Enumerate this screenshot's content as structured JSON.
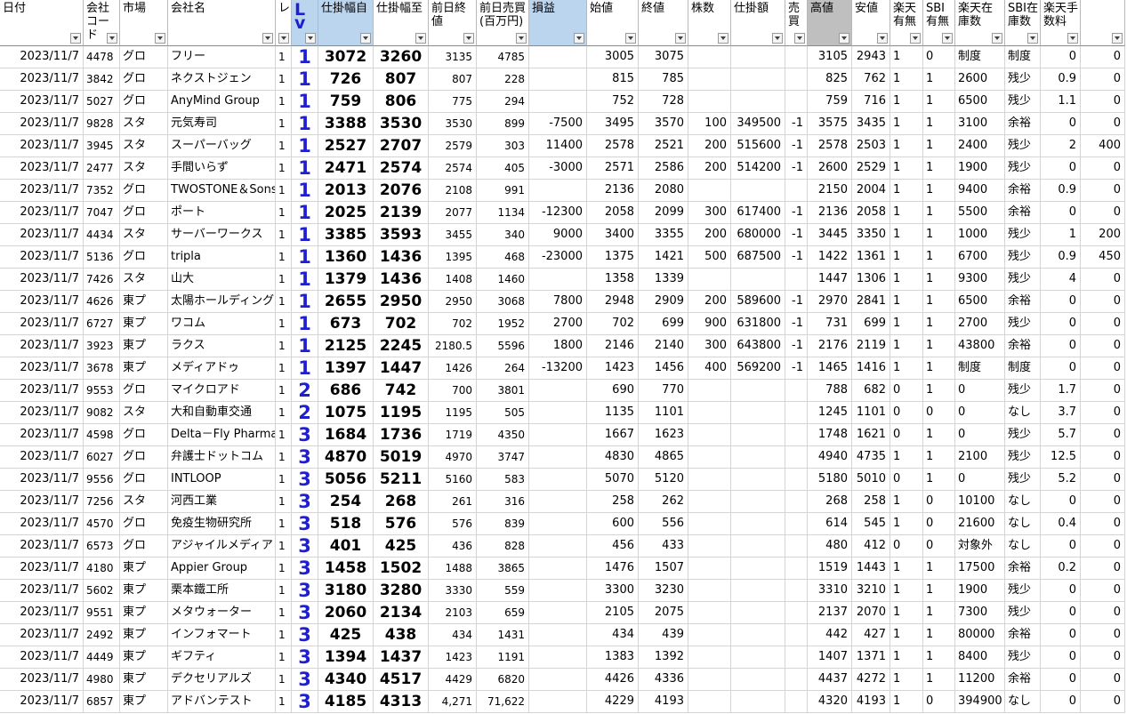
{
  "columns": [
    {
      "key": "date",
      "label": "日付",
      "align": "r",
      "bg": ""
    },
    {
      "key": "code",
      "label": "会社コード",
      "align": "l",
      "bg": "",
      "sm": true
    },
    {
      "key": "market",
      "label": "市場",
      "align": "l",
      "bg": ""
    },
    {
      "key": "name",
      "label": "会社名",
      "align": "l",
      "bg": ""
    },
    {
      "key": "re",
      "label": "レ",
      "align": "l",
      "bg": "",
      "sm": true
    },
    {
      "key": "lv",
      "label": "Lv",
      "align": "c",
      "bg": "blue",
      "lv": true
    },
    {
      "key": "from",
      "label": "仕掛幅自",
      "align": "c",
      "bg": "blue",
      "big": true
    },
    {
      "key": "to",
      "label": "仕掛幅至",
      "align": "c",
      "bg": "",
      "big": true
    },
    {
      "key": "prev",
      "label": "前日終値",
      "align": "r",
      "bg": "",
      "sm": true
    },
    {
      "key": "vol",
      "label": "前日売買(百万円)",
      "align": "r",
      "bg": "",
      "sm": true
    },
    {
      "key": "pl",
      "label": "損益",
      "align": "r",
      "bg": "blue"
    },
    {
      "key": "open",
      "label": "始値",
      "align": "r",
      "bg": ""
    },
    {
      "key": "close",
      "label": "終値",
      "align": "r",
      "bg": ""
    },
    {
      "key": "shares",
      "label": "株数",
      "align": "r",
      "bg": ""
    },
    {
      "key": "amount",
      "label": "仕掛額",
      "align": "r",
      "bg": ""
    },
    {
      "key": "bs",
      "label": "売買",
      "align": "r",
      "bg": ""
    },
    {
      "key": "high",
      "label": "高値",
      "align": "r",
      "bg": "gray"
    },
    {
      "key": "low",
      "label": "安値",
      "align": "r",
      "bg": ""
    },
    {
      "key": "rak",
      "label": "楽天有無",
      "align": "l",
      "bg": ""
    },
    {
      "key": "sbi",
      "label": "SBI有無",
      "align": "l",
      "bg": ""
    },
    {
      "key": "rakstock",
      "label": "楽天在庫数",
      "align": "l",
      "bg": ""
    },
    {
      "key": "sbistock",
      "label": "SBI在庫数",
      "align": "l",
      "bg": ""
    },
    {
      "key": "fee1",
      "label": "楽天手数料",
      "align": "r",
      "bg": ""
    },
    {
      "key": "fee2",
      "label": "",
      "align": "r",
      "bg": ""
    }
  ],
  "rows": [
    [
      "2023/11/7",
      "4478",
      "グロ",
      "フリー",
      "1",
      "1",
      "3072",
      "3260",
      "3135",
      "4785",
      "",
      "3005",
      "3075",
      "",
      "",
      "",
      "3105",
      "2943",
      "1",
      "0",
      "制度",
      "制度",
      "0",
      "0"
    ],
    [
      "2023/11/7",
      "3842",
      "グロ",
      "ネクストジェン",
      "1",
      "1",
      "726",
      "807",
      "807",
      "228",
      "",
      "815",
      "785",
      "",
      "",
      "",
      "825",
      "762",
      "1",
      "1",
      "2600",
      "残少",
      "0.9",
      "0"
    ],
    [
      "2023/11/7",
      "5027",
      "グロ",
      "AnyMind Group",
      "1",
      "1",
      "759",
      "806",
      "775",
      "294",
      "",
      "752",
      "728",
      "",
      "",
      "",
      "759",
      "716",
      "1",
      "1",
      "6500",
      "残少",
      "1.1",
      "0"
    ],
    [
      "2023/11/7",
      "9828",
      "スタ",
      "元気寿司",
      "1",
      "1",
      "3388",
      "3530",
      "3530",
      "899",
      "-7500",
      "3495",
      "3570",
      "100",
      "349500",
      "-1",
      "3575",
      "3435",
      "1",
      "1",
      "3100",
      "余裕",
      "0",
      "0"
    ],
    [
      "2023/11/7",
      "3945",
      "スタ",
      "スーパーバッグ",
      "1",
      "1",
      "2527",
      "2707",
      "2579",
      "303",
      "11400",
      "2578",
      "2521",
      "200",
      "515600",
      "-1",
      "2578",
      "2503",
      "1",
      "1",
      "2400",
      "残少",
      "2",
      "400"
    ],
    [
      "2023/11/7",
      "2477",
      "スタ",
      "手間いらず",
      "1",
      "1",
      "2471",
      "2574",
      "2574",
      "405",
      "-3000",
      "2571",
      "2586",
      "200",
      "514200",
      "-1",
      "2600",
      "2529",
      "1",
      "1",
      "1900",
      "残少",
      "0",
      "0"
    ],
    [
      "2023/11/7",
      "7352",
      "グロ",
      "TWOSTONE＆Sons",
      "1",
      "1",
      "2013",
      "2076",
      "2108",
      "991",
      "",
      "2136",
      "2080",
      "",
      "",
      "",
      "2150",
      "2004",
      "1",
      "1",
      "9400",
      "余裕",
      "0.9",
      "0"
    ],
    [
      "2023/11/7",
      "7047",
      "グロ",
      "ポート",
      "1",
      "1",
      "2025",
      "2139",
      "2077",
      "1134",
      "-12300",
      "2058",
      "2099",
      "300",
      "617400",
      "-1",
      "2136",
      "2058",
      "1",
      "1",
      "5500",
      "余裕",
      "0",
      "0"
    ],
    [
      "2023/11/7",
      "4434",
      "スタ",
      "サーバーワークス",
      "1",
      "1",
      "3385",
      "3593",
      "3455",
      "340",
      "9000",
      "3400",
      "3355",
      "200",
      "680000",
      "-1",
      "3445",
      "3350",
      "1",
      "1",
      "1000",
      "残少",
      "1",
      "200"
    ],
    [
      "2023/11/7",
      "5136",
      "グロ",
      "tripla",
      "1",
      "1",
      "1360",
      "1436",
      "1395",
      "468",
      "-23000",
      "1375",
      "1421",
      "500",
      "687500",
      "-1",
      "1422",
      "1361",
      "1",
      "1",
      "6700",
      "残少",
      "0.9",
      "450"
    ],
    [
      "2023/11/7",
      "7426",
      "スタ",
      "山大",
      "1",
      "1",
      "1379",
      "1436",
      "1408",
      "1460",
      "",
      "1358",
      "1339",
      "",
      "",
      "",
      "1447",
      "1306",
      "1",
      "1",
      "9300",
      "残少",
      "4",
      "0"
    ],
    [
      "2023/11/7",
      "4626",
      "東プ",
      "太陽ホールディングス",
      "1",
      "1",
      "2655",
      "2950",
      "2950",
      "3068",
      "7800",
      "2948",
      "2909",
      "200",
      "589600",
      "-1",
      "2970",
      "2841",
      "1",
      "1",
      "6500",
      "余裕",
      "0",
      "0"
    ],
    [
      "2023/11/7",
      "6727",
      "東プ",
      "ワコム",
      "1",
      "1",
      "673",
      "702",
      "702",
      "1952",
      "2700",
      "702",
      "699",
      "900",
      "631800",
      "-1",
      "731",
      "699",
      "1",
      "1",
      "2700",
      "残少",
      "0",
      "0"
    ],
    [
      "2023/11/7",
      "3923",
      "東プ",
      "ラクス",
      "1",
      "1",
      "2125",
      "2245",
      "2180.5",
      "5596",
      "1800",
      "2146",
      "2140",
      "300",
      "643800",
      "-1",
      "2176",
      "2119",
      "1",
      "1",
      "43800",
      "余裕",
      "0",
      "0"
    ],
    [
      "2023/11/7",
      "3678",
      "東プ",
      "メディアドゥ",
      "1",
      "1",
      "1397",
      "1447",
      "1426",
      "264",
      "-13200",
      "1423",
      "1456",
      "400",
      "569200",
      "-1",
      "1465",
      "1416",
      "1",
      "1",
      "制度",
      "制度",
      "0",
      "0"
    ],
    [
      "2023/11/7",
      "9553",
      "グロ",
      "マイクロアド",
      "1",
      "2",
      "686",
      "742",
      "700",
      "3801",
      "",
      "690",
      "770",
      "",
      "",
      "",
      "788",
      "682",
      "0",
      "1",
      "0",
      "残少",
      "1.7",
      "0"
    ],
    [
      "2023/11/7",
      "9082",
      "スタ",
      "大和自動車交通",
      "1",
      "2",
      "1075",
      "1195",
      "1195",
      "505",
      "",
      "1135",
      "1101",
      "",
      "",
      "",
      "1245",
      "1101",
      "0",
      "0",
      "0",
      "なし",
      "3.7",
      "0"
    ],
    [
      "2023/11/7",
      "4598",
      "グロ",
      "Delta－Fly Pharma",
      "1",
      "3",
      "1684",
      "1736",
      "1719",
      "4350",
      "",
      "1667",
      "1623",
      "",
      "",
      "",
      "1748",
      "1621",
      "0",
      "1",
      "0",
      "残少",
      "5.7",
      "0"
    ],
    [
      "2023/11/7",
      "6027",
      "グロ",
      "弁護士ドットコム",
      "1",
      "3",
      "4870",
      "5019",
      "4970",
      "3747",
      "",
      "4830",
      "4865",
      "",
      "",
      "",
      "4940",
      "4735",
      "1",
      "1",
      "2100",
      "残少",
      "12.5",
      "0"
    ],
    [
      "2023/11/7",
      "9556",
      "グロ",
      "INTLOOP",
      "1",
      "3",
      "5056",
      "5211",
      "5160",
      "583",
      "",
      "5070",
      "5120",
      "",
      "",
      "",
      "5180",
      "5010",
      "0",
      "1",
      "0",
      "残少",
      "5.2",
      "0"
    ],
    [
      "2023/11/7",
      "7256",
      "スタ",
      "河西工業",
      "1",
      "3",
      "254",
      "268",
      "261",
      "316",
      "",
      "258",
      "262",
      "",
      "",
      "",
      "268",
      "258",
      "1",
      "0",
      "10100",
      "なし",
      "0",
      "0"
    ],
    [
      "2023/11/7",
      "4570",
      "グロ",
      "免疫生物研究所",
      "1",
      "3",
      "518",
      "576",
      "576",
      "839",
      "",
      "600",
      "556",
      "",
      "",
      "",
      "614",
      "545",
      "1",
      "0",
      "21600",
      "なし",
      "0.4",
      "0"
    ],
    [
      "2023/11/7",
      "6573",
      "グロ",
      "アジャイルメディア・ネットワーク",
      "1",
      "3",
      "401",
      "425",
      "436",
      "828",
      "",
      "456",
      "433",
      "",
      "",
      "",
      "480",
      "412",
      "0",
      "0",
      "対象外",
      "なし",
      "0",
      "0"
    ],
    [
      "2023/11/7",
      "4180",
      "東プ",
      "Appier Group",
      "1",
      "3",
      "1458",
      "1502",
      "1488",
      "3865",
      "",
      "1476",
      "1507",
      "",
      "",
      "",
      "1519",
      "1443",
      "1",
      "1",
      "17500",
      "余裕",
      "0.2",
      "0"
    ],
    [
      "2023/11/7",
      "5602",
      "東プ",
      "栗本鐵工所",
      "1",
      "3",
      "3180",
      "3280",
      "3330",
      "559",
      "",
      "3300",
      "3230",
      "",
      "",
      "",
      "3310",
      "3210",
      "1",
      "1",
      "1900",
      "残少",
      "0",
      "0"
    ],
    [
      "2023/11/7",
      "9551",
      "東プ",
      "メタウォーター",
      "1",
      "3",
      "2060",
      "2134",
      "2103",
      "659",
      "",
      "2105",
      "2075",
      "",
      "",
      "",
      "2137",
      "2070",
      "1",
      "1",
      "7300",
      "残少",
      "0",
      "0"
    ],
    [
      "2023/11/7",
      "2492",
      "東プ",
      "インフォマート",
      "1",
      "3",
      "425",
      "438",
      "434",
      "1431",
      "",
      "434",
      "439",
      "",
      "",
      "",
      "442",
      "427",
      "1",
      "1",
      "80000",
      "余裕",
      "0",
      "0"
    ],
    [
      "2023/11/7",
      "4449",
      "東プ",
      "ギフティ",
      "1",
      "3",
      "1394",
      "1437",
      "1423",
      "1191",
      "",
      "1383",
      "1392",
      "",
      "",
      "",
      "1407",
      "1371",
      "1",
      "1",
      "8400",
      "残少",
      "0",
      "0"
    ],
    [
      "2023/11/7",
      "4980",
      "東プ",
      "デクセリアルズ",
      "1",
      "3",
      "4340",
      "4517",
      "4429",
      "6820",
      "",
      "4426",
      "4336",
      "",
      "",
      "",
      "4437",
      "4272",
      "1",
      "1",
      "11200",
      "余裕",
      "0",
      "0"
    ],
    [
      "2023/11/7",
      "6857",
      "東プ",
      "アドバンテスト",
      "1",
      "3",
      "4185",
      "4313",
      "4,271",
      "71,622",
      "",
      "4229",
      "4193",
      "",
      "",
      "",
      "4320",
      "4193",
      "1",
      "0",
      "394900",
      "なし",
      "0",
      "0"
    ]
  ],
  "colors": {
    "header_blue": "#bcd5ee",
    "header_gray": "#bfbfbf",
    "lv_blue": "#1f1fd0",
    "grid": "#d4d4d4"
  },
  "filter_icon": "dropdown-filter-icon"
}
